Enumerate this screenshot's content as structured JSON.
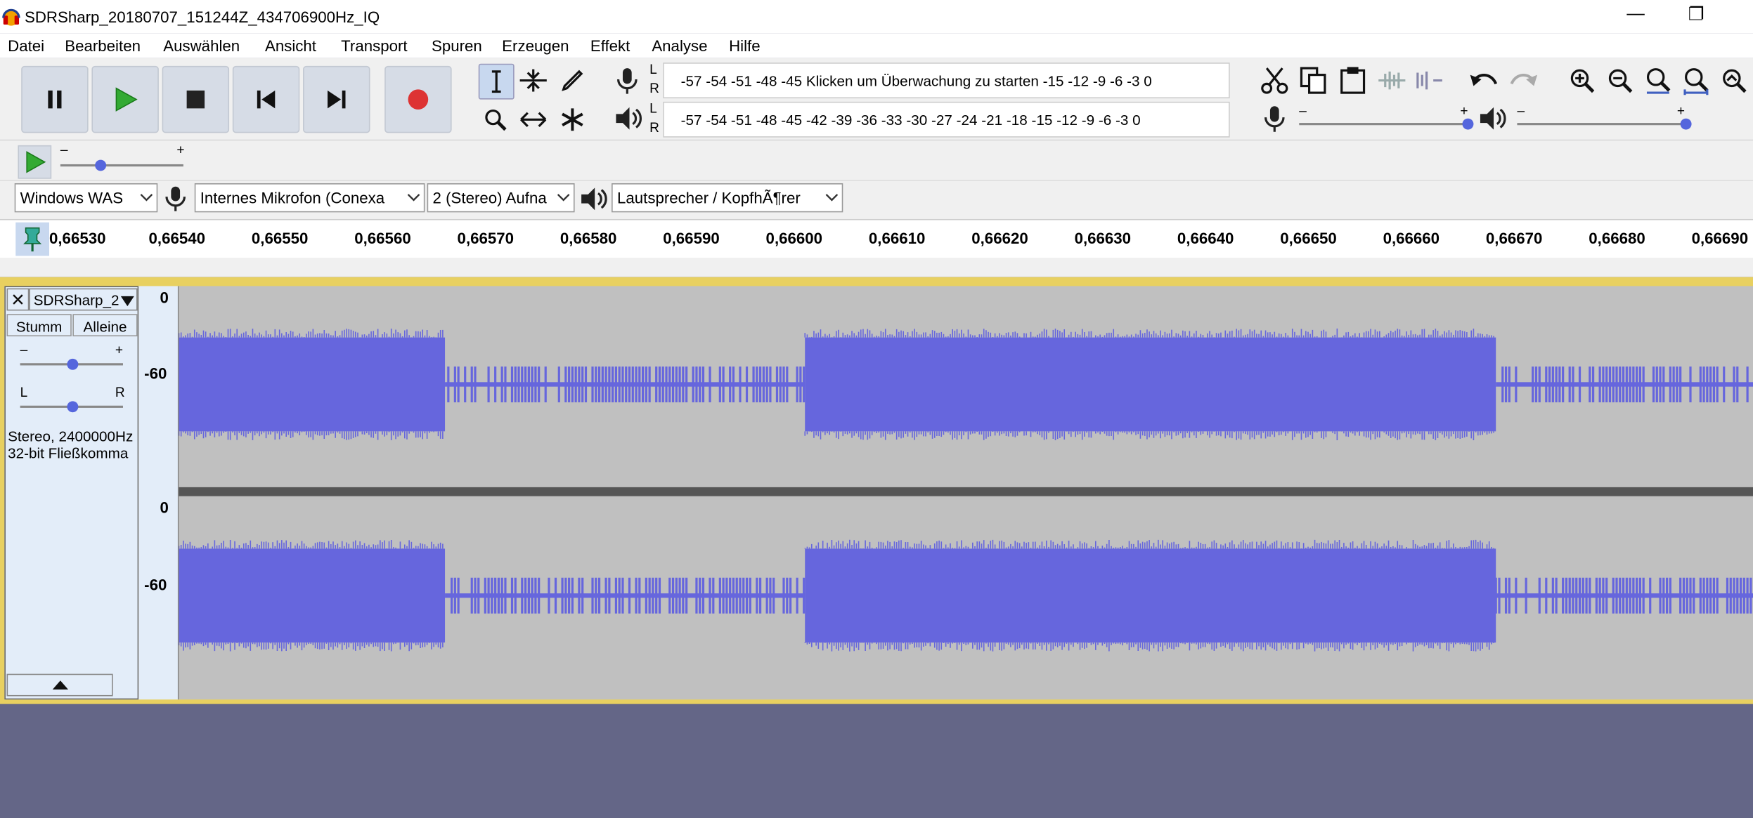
{
  "window": {
    "title": "SDRSharp_20180707_151244Z_434706900Hz_IQ"
  },
  "menu": [
    "Datei",
    "Bearbeiten",
    "Auswählen",
    "Ansicht",
    "Transport",
    "Spuren",
    "Erzeugen",
    "Effekt",
    "Analyse",
    "Hilfe"
  ],
  "meters": {
    "rec_scale": "-57 -54 -51 -48 -45 Klicken um Überwachung zu starten -15 -12  -9  -6  -3  0",
    "play_scale": "-57 -54 -51 -48 -45 -42 -39 -36 -33 -30 -27 -24 -21 -18 -15 -12  -9  -6  -3  0",
    "l": "L",
    "r": "R"
  },
  "sliders": {
    "minus": "–",
    "plus": "+"
  },
  "devices": {
    "host": "Windows WAS",
    "mic": "Internes Mikrofon (Conexa",
    "channels": "2 (Stereo) Aufna",
    "speaker": "Lautsprecher / KopfhÃ¶rer"
  },
  "ruler": [
    "0,66530",
    "0,66540",
    "0,66550",
    "0,66560",
    "0,66570",
    "0,66580",
    "0,66590",
    "0,66600",
    "0,66610",
    "0,66620",
    "0,66630",
    "0,66640",
    "0,66650",
    "0,66660",
    "0,66670",
    "0,66680",
    "0,66690"
  ],
  "track": {
    "name": "SDRSharp_2",
    "mute": "Stumm",
    "solo": "Alleine",
    "gain_minus": "–",
    "gain_plus": "+",
    "pan_l": "L",
    "pan_r": "R",
    "info1": "Stereo, 2400000Hz",
    "info2": "32-bit Fließkomma",
    "scale_top": "0",
    "scale_mid": "-60"
  },
  "colors": {
    "waveform": "#6666dd",
    "record": "#dd3333",
    "play": "#33aa33",
    "accent": "#5555dd"
  }
}
